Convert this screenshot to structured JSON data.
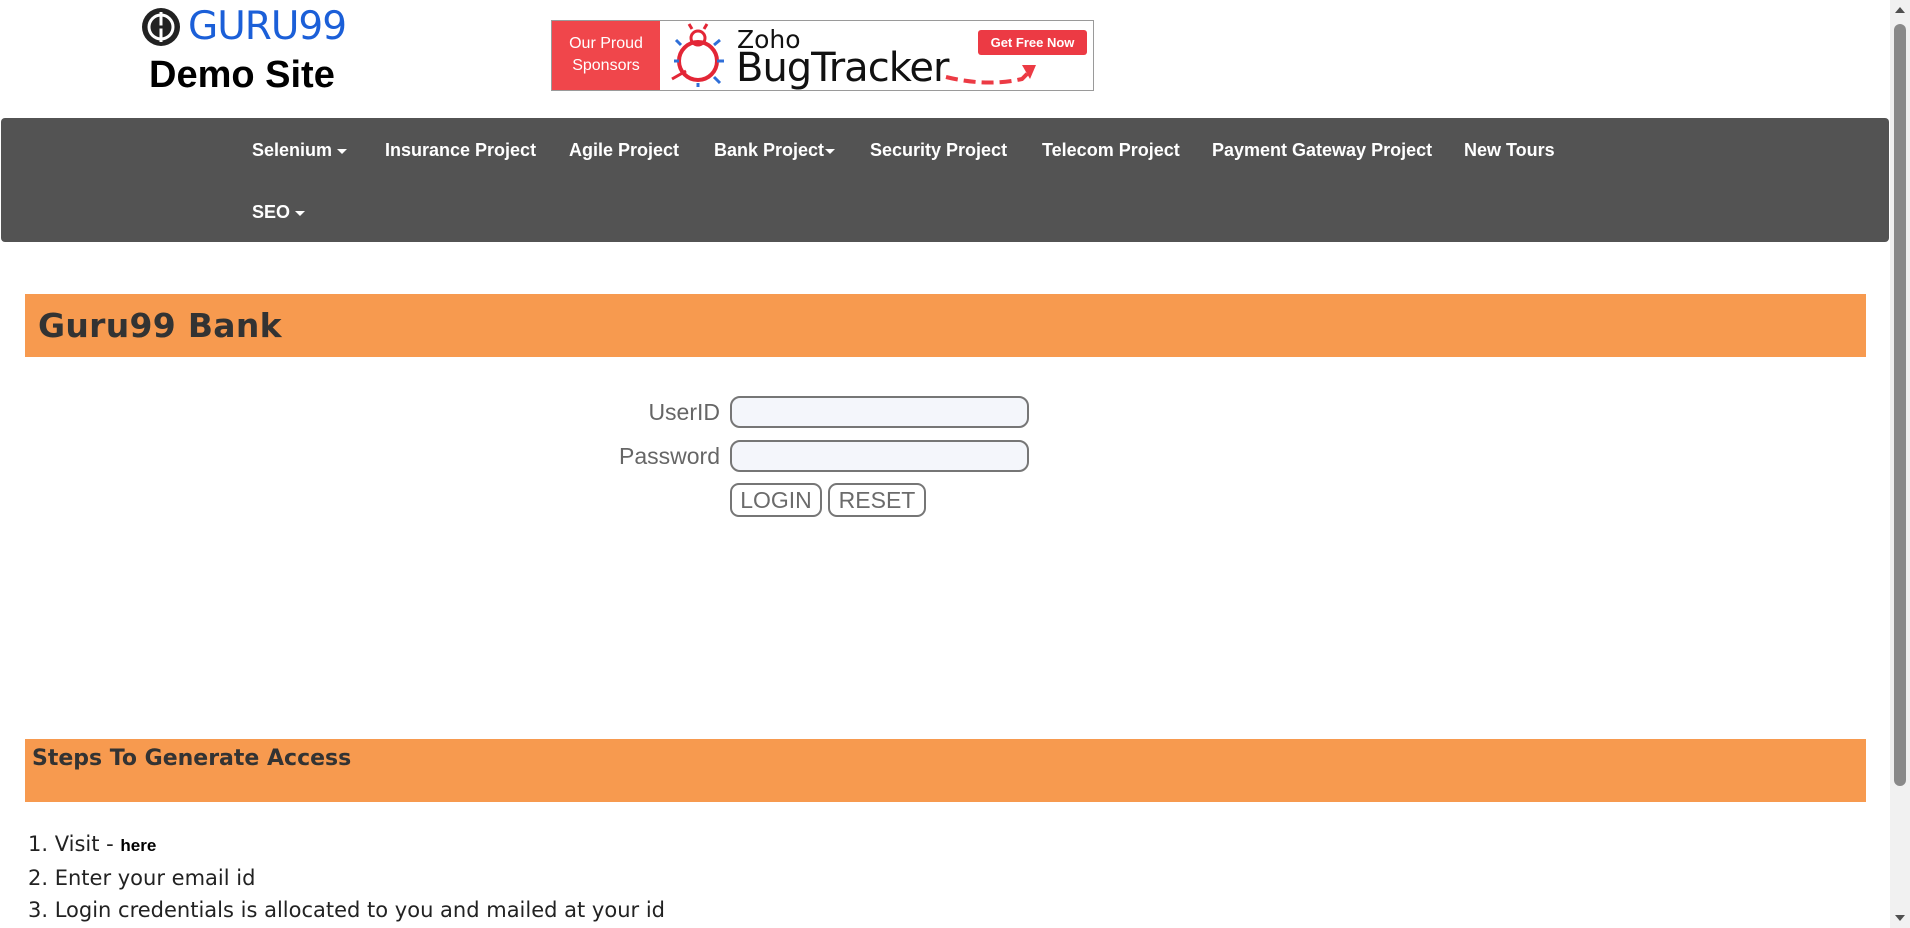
{
  "header": {
    "logo_text": "GURU99",
    "subtitle": "Demo Site",
    "sponsor": {
      "left_line1": "Our Proud",
      "left_line2": "Sponsors",
      "brand": "Zoho",
      "product": "BugTracker",
      "cta": "Get Free Now"
    }
  },
  "nav": {
    "items": [
      {
        "label": "Selenium",
        "dropdown": true
      },
      {
        "label": "Insurance Project",
        "dropdown": false
      },
      {
        "label": "Agile Project",
        "dropdown": false
      },
      {
        "label": "Bank Project",
        "dropdown": true
      },
      {
        "label": "Security Project",
        "dropdown": false
      },
      {
        "label": "Telecom Project",
        "dropdown": false
      },
      {
        "label": "Payment Gateway Project",
        "dropdown": false
      },
      {
        "label": "New Tours",
        "dropdown": false
      },
      {
        "label": "SEO",
        "dropdown": true
      }
    ]
  },
  "bank": {
    "title": "Guru99 Bank",
    "userid_label": "UserID",
    "userid_value": "",
    "password_label": "Password",
    "password_value": "",
    "login_button": "LOGIN",
    "reset_button": "RESET"
  },
  "steps": {
    "title": "Steps To Generate Access",
    "items": [
      {
        "text": "1. Visit - ",
        "link": "here"
      },
      {
        "text": "2. Enter your email id"
      },
      {
        "text": "3. Login credentials is allocated to you and mailed at your id"
      }
    ]
  },
  "colors": {
    "accent_orange": "#f79a4f",
    "nav_bg": "#535353",
    "logo_blue": "#1b5fd8",
    "sponsor_red": "#f0464b"
  }
}
